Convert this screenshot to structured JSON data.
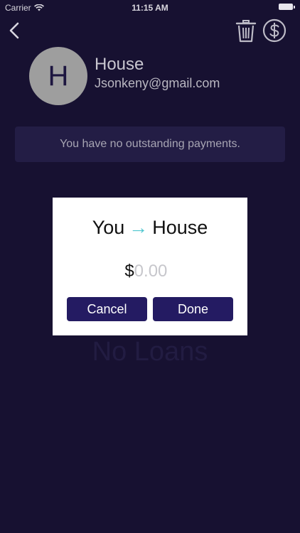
{
  "status_bar": {
    "carrier": "Carrier",
    "time": "11:15 AM"
  },
  "nav": {
    "back_icon": "chevron-left-icon",
    "delete_icon": "trash-icon",
    "payment_icon": "dollar-circle-icon"
  },
  "profile": {
    "initial": "H",
    "name": "House",
    "email": "Jsonkeny@gmail.com"
  },
  "payments_banner": "You have no outstanding payments.",
  "empty_state": "No Loans",
  "dialog": {
    "from": "You",
    "to": "House",
    "currency_symbol": "$",
    "amount_value": "",
    "amount_placeholder": "0.00",
    "cancel_label": "Cancel",
    "done_label": "Done"
  },
  "colors": {
    "background": "#171131",
    "accent_button": "#241b62",
    "arrow": "#4fc6cf",
    "avatar": "#9e9e9e",
    "banner": "#231d45"
  }
}
